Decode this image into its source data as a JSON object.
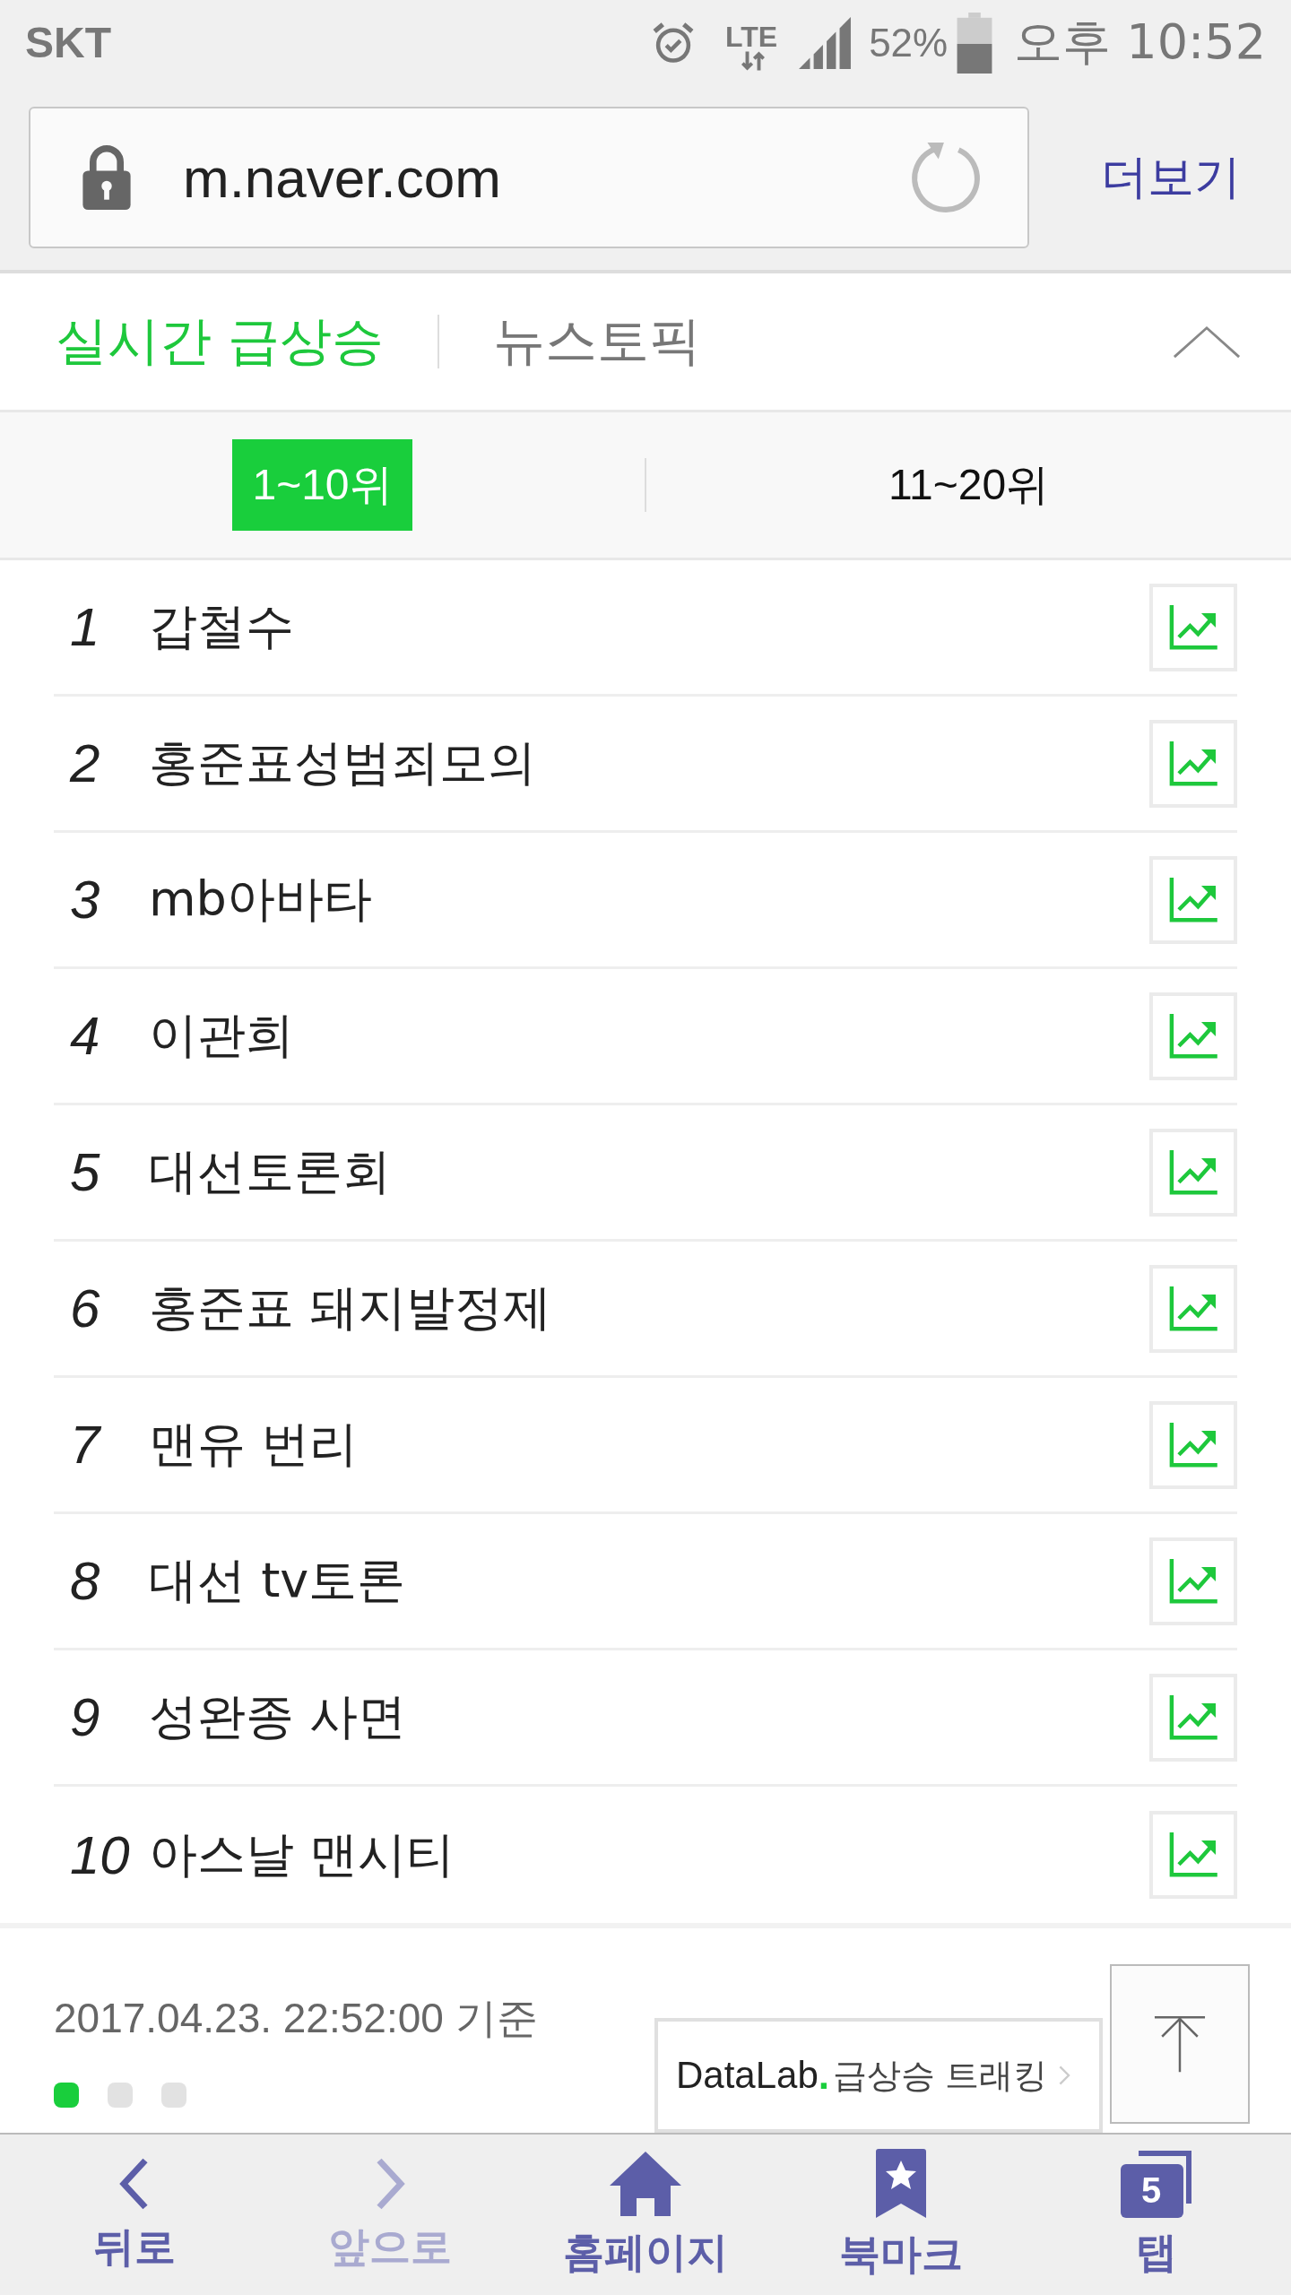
{
  "status_bar": {
    "carrier": "SKT",
    "network": "LTE",
    "battery": "52%",
    "time": "오후 10:52"
  },
  "address_bar": {
    "url": "m.naver.com",
    "more": "더보기"
  },
  "tabs": [
    {
      "label": "실시간 급상승",
      "selected": true
    },
    {
      "label": "뉴스토픽",
      "selected": false
    }
  ],
  "range_tabs": [
    {
      "label": "1~10위",
      "selected": true
    },
    {
      "label": "11~20위",
      "selected": false
    }
  ],
  "keywords": [
    {
      "rank": "1",
      "text": "갑철수"
    },
    {
      "rank": "2",
      "text": "홍준표성범죄모의"
    },
    {
      "rank": "3",
      "text": "mb아바타"
    },
    {
      "rank": "4",
      "text": "이관희"
    },
    {
      "rank": "5",
      "text": "대선토론회"
    },
    {
      "rank": "6",
      "text": "홍준표 돼지발정제"
    },
    {
      "rank": "7",
      "text": "맨유 번리"
    },
    {
      "rank": "8",
      "text": "대선 tv토론"
    },
    {
      "rank": "9",
      "text": "성완종 사면"
    },
    {
      "rank": "10",
      "text": "아스날 맨시티"
    }
  ],
  "footer": {
    "timestamp": "2017.04.23. 22:52:00 기준",
    "pages": [
      {
        "selected": true
      },
      {
        "selected": false
      },
      {
        "selected": false
      }
    ],
    "datalab": {
      "brand": "DataLab",
      "dot": ".",
      "label": "급상승 트래킹"
    }
  },
  "bottom_nav": [
    {
      "kind": "back",
      "label": "뒤로",
      "disabled": false
    },
    {
      "kind": "forward",
      "label": "앞으로",
      "disabled": true
    },
    {
      "kind": "home",
      "label": "홈페이지",
      "disabled": false
    },
    {
      "kind": "bookmark",
      "label": "북마크",
      "disabled": false
    },
    {
      "kind": "tabs",
      "label": "탭",
      "count": "5",
      "disabled": false
    }
  ]
}
